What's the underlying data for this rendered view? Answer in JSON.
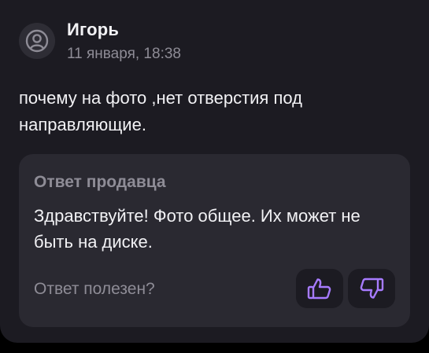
{
  "review": {
    "author": "Игорь",
    "date": "11 января, 18:38",
    "text": "почему на фото ,нет отверстия под направляющие."
  },
  "seller_reply": {
    "title": "Ответ продавца",
    "text": "Здравствуйте! Фото общее. Их может не быть на диске.",
    "helpful_question": "Ответ полезен?"
  },
  "icons": {
    "avatar": "user-avatar-icon",
    "like": "thumbs-up-icon",
    "dislike": "thumbs-down-icon"
  },
  "colors": {
    "background": "#000000",
    "card": "#1c1b22",
    "reply_card": "#2a2931",
    "text_primary": "#f2f2f5",
    "text_secondary": "#8e8c96",
    "accent": "#a77bff"
  }
}
